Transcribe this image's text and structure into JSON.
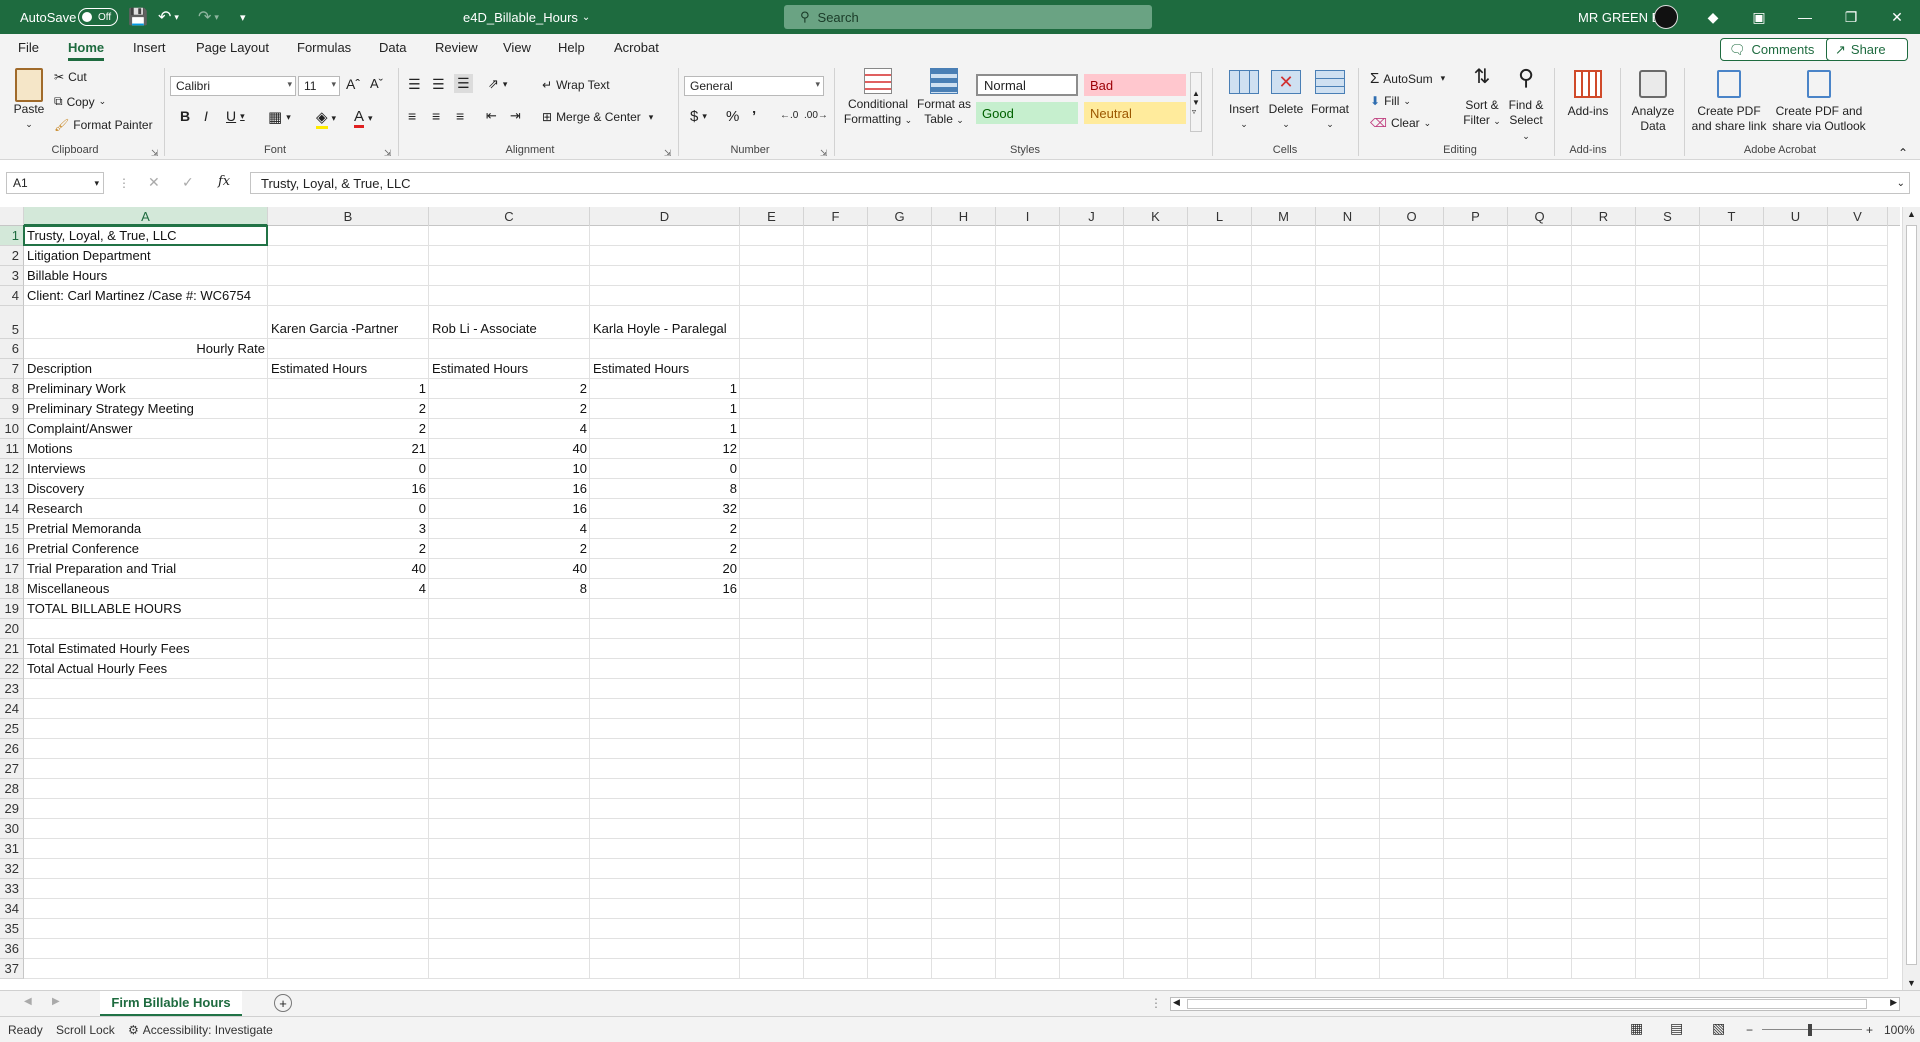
{
  "titlebar": {
    "autosave_label": "AutoSave",
    "autosave_state": "Off",
    "file_name": "e4D_Billable_Hours",
    "search_placeholder": "Search",
    "user_name": "MR GREEN B"
  },
  "menu": {
    "tabs": [
      "File",
      "Home",
      "Insert",
      "Page Layout",
      "Formulas",
      "Data",
      "Review",
      "View",
      "Help",
      "Acrobat"
    ],
    "active": "Home",
    "comments_label": "Comments",
    "share_label": "Share"
  },
  "ribbon": {
    "clipboard": {
      "paste": "Paste",
      "cut": "Cut",
      "copy": "Copy",
      "format_painter": "Format Painter",
      "label": "Clipboard"
    },
    "font": {
      "name": "Calibri",
      "size": "11",
      "label": "Font"
    },
    "alignment": {
      "wrap_text": "Wrap Text",
      "merge_center": "Merge & Center",
      "label": "Alignment"
    },
    "number": {
      "format": "General",
      "label": "Number"
    },
    "styles": {
      "conditional_formatting": [
        "Conditional",
        "Formatting"
      ],
      "format_as_table": [
        "Format as",
        "Table"
      ],
      "normal": "Normal",
      "bad": "Bad",
      "good": "Good",
      "neutral": "Neutral",
      "label": "Styles"
    },
    "cells": {
      "insert": "Insert",
      "delete": "Delete",
      "format": "Format",
      "label": "Cells"
    },
    "editing": {
      "autosum": "AutoSum",
      "fill": "Fill",
      "clear": "Clear",
      "sort_filter": [
        "Sort &",
        "Filter"
      ],
      "find_select": [
        "Find &",
        "Select"
      ],
      "label": "Editing"
    },
    "addins": {
      "addins": "Add-ins",
      "label": "Add-ins"
    },
    "analyze": {
      "label": [
        "Analyze",
        "Data"
      ]
    },
    "acrobat": {
      "create_pdf_link": [
        "Create PDF",
        "and share link"
      ],
      "create_pdf_outlook": [
        "Create PDF and",
        "share via Outlook"
      ],
      "label": "Adobe Acrobat"
    }
  },
  "formula_bar": {
    "name_box": "A1",
    "fx": "fx",
    "content": "Trusty, Loyal, & True, LLC"
  },
  "columns": [
    "A",
    "B",
    "C",
    "D",
    "E",
    "F",
    "G",
    "H",
    "I",
    "J",
    "K",
    "L",
    "M",
    "N",
    "O",
    "P",
    "Q",
    "R",
    "S",
    "T",
    "U",
    "V"
  ],
  "sheet": {
    "A1": "Trusty, Loyal, & True, LLC",
    "A2": "Litigation Department",
    "A3": "Billable Hours",
    "A4": "Client: Carl Martinez /Case #:  WC6754",
    "B5": "Karen Garcia -Partner",
    "C5": "Rob Li - Associate",
    "D5": "Karla Hoyle - Paralegal",
    "A6": "Hourly Rate",
    "A7": "Description",
    "B7": "Estimated Hours",
    "C7": "Estimated Hours",
    "D7": "Estimated Hours",
    "rows": [
      {
        "desc": "Preliminary Work",
        "b": "1",
        "c": "2",
        "d": "1"
      },
      {
        "desc": "Preliminary Strategy Meeting",
        "b": "2",
        "c": "2",
        "d": "1"
      },
      {
        "desc": "Complaint/Answer",
        "b": "2",
        "c": "4",
        "d": "1"
      },
      {
        "desc": "Motions",
        "b": "21",
        "c": "40",
        "d": "12"
      },
      {
        "desc": "Interviews",
        "b": "0",
        "c": "10",
        "d": "0"
      },
      {
        "desc": "Discovery",
        "b": "16",
        "c": "16",
        "d": "8"
      },
      {
        "desc": "Research",
        "b": "0",
        "c": "16",
        "d": "32"
      },
      {
        "desc": "Pretrial Memoranda",
        "b": "3",
        "c": "4",
        "d": "2"
      },
      {
        "desc": "Pretrial Conference",
        "b": "2",
        "c": "2",
        "d": "2"
      },
      {
        "desc": "Trial Preparation and Trial",
        "b": "40",
        "c": "40",
        "d": "20"
      },
      {
        "desc": "Miscellaneous",
        "b": "4",
        "c": "8",
        "d": "16"
      }
    ],
    "A19": "TOTAL BILLABLE HOURS",
    "A21": "Total Estimated Hourly Fees",
    "A22": "Total Actual Hourly Fees"
  },
  "row_numbers": [
    "1",
    "2",
    "3",
    "4",
    "5",
    "6",
    "7",
    "8",
    "9",
    "10",
    "11",
    "12",
    "13",
    "14",
    "15",
    "16",
    "17",
    "18",
    "19",
    "20",
    "21",
    "22",
    "23",
    "24",
    "25",
    "26",
    "27",
    "28",
    "29",
    "30",
    "31",
    "32",
    "33",
    "34",
    "35",
    "36",
    "37"
  ],
  "sheet_tab": "Firm Billable Hours",
  "status": {
    "ready": "Ready",
    "scroll_lock": "Scroll Lock",
    "accessibility": "Accessibility: Investigate",
    "zoom": "100%"
  }
}
